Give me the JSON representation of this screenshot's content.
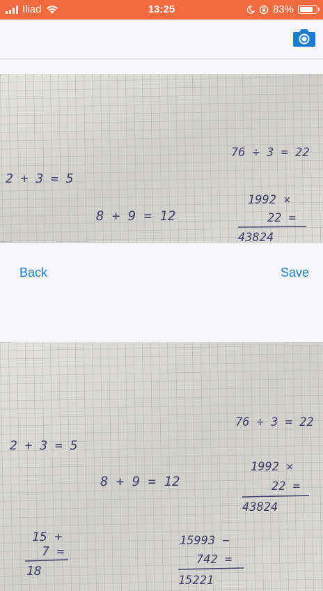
{
  "status_bar": {
    "carrier": "Iliad",
    "time": "13:25",
    "battery_percent": "83%",
    "battery_level": 0.83,
    "icons": [
      "signal-icon",
      "wifi-icon",
      "moon-icon",
      "orientation-lock-icon",
      "battery-icon"
    ]
  },
  "nav_bar": {
    "right_icon": "camera-icon",
    "accent_color": "#1e7ccf"
  },
  "toolbar": {
    "back_label": "Back",
    "save_label": "Save"
  },
  "photo_top": {
    "equations": [
      "76 ÷ 3 = 22",
      "2 + 3 = 5",
      "8 + 9 = 12",
      "1992 ×",
      "22 =",
      "43824"
    ]
  },
  "photo_bottom": {
    "equations": [
      "76 ÷ 3 = 22",
      "2 + 3 = 5",
      "8 + 9 = 12",
      "1992 ×",
      "22 =",
      "43824",
      "15 +",
      "7 =",
      "18",
      "15993 −",
      "742 =",
      "15221"
    ]
  },
  "colors": {
    "status_bar_bg": "#f46a3f",
    "link": "#1e7ccf",
    "ink": "#3d3f66",
    "paper": "#d9d8d4"
  }
}
